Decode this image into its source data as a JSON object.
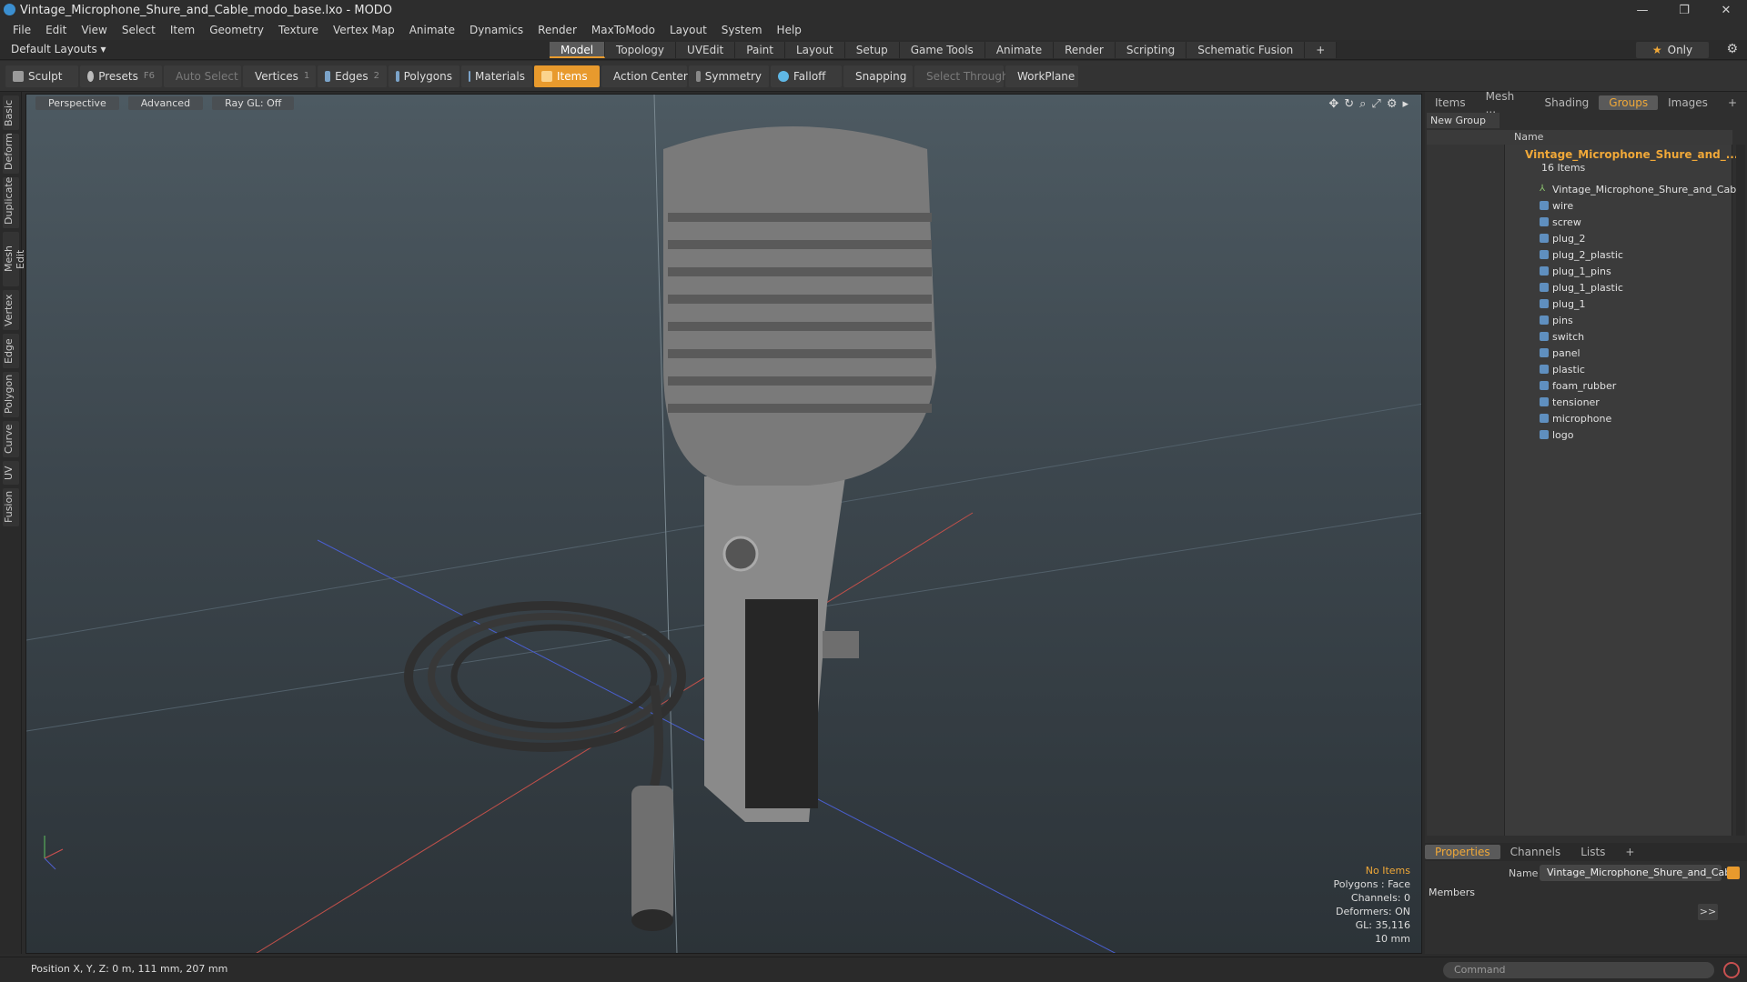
{
  "window": {
    "title": "Vintage_Microphone_Shure_and_Cable_modo_base.lxo - MODO"
  },
  "menu": [
    "File",
    "Edit",
    "View",
    "Select",
    "Item",
    "Geometry",
    "Texture",
    "Vertex Map",
    "Animate",
    "Dynamics",
    "Render",
    "MaxToModo",
    "Layout",
    "System",
    "Help"
  ],
  "layout": {
    "selector": "Default Layouts ▾",
    "tabs": [
      "Model",
      "Topology",
      "UVEdit",
      "Paint",
      "Layout",
      "Setup",
      "Game Tools",
      "Animate",
      "Render",
      "Scripting",
      "Schematic Fusion"
    ],
    "add": "+",
    "only": "Only"
  },
  "toolbar": {
    "sculpt": "Sculpt",
    "presets": "Presets",
    "presets_key": "F6",
    "auto_select": "Auto Select",
    "vertices": "Vertices",
    "vertices_num": "1",
    "edges": "Edges",
    "edges_num": "2",
    "polygons": "Polygons",
    "materials": "Materials",
    "items": "Items",
    "action_center": "Action Center",
    "symmetry": "Symmetry",
    "falloff": "Falloff",
    "snapping": "Snapping",
    "select_through": "Select Through",
    "workplane": "WorkPlane"
  },
  "left_tabs": [
    "Basic",
    "Deform",
    "Duplicate",
    "Mesh Edit",
    "Vertex",
    "Edge",
    "Polygon",
    "Curve",
    "UV",
    "Fusion"
  ],
  "viewport": {
    "perspective": "Perspective",
    "advanced": "Advanced",
    "raygl": "Ray GL: Off",
    "hud": {
      "no_items": "No Items",
      "polygons": "Polygons : Face",
      "channels": "Channels: 0",
      "deformers": "Deformers: ON",
      "gl": "GL: 35,116",
      "scale": "10 mm"
    }
  },
  "groups_panel": {
    "tabs": [
      "Items",
      "Mesh ...",
      "Shading",
      "Groups",
      "Images",
      "+"
    ],
    "new_group": "New Group",
    "col_name": "Name",
    "group_name": "Vintage_Microphone_Shure_and_...",
    "group_count": "16 Items",
    "items": [
      "Vintage_Microphone_Shure_and_Cable",
      "wire",
      "screw",
      "plug_2",
      "plug_2_plastic",
      "plug_1_pins",
      "plug_1_plastic",
      "plug_1",
      "pins",
      "switch",
      "panel",
      "plastic",
      "foam_rubber",
      "tensioner",
      "microphone",
      "logo"
    ]
  },
  "properties": {
    "tabs": [
      "Properties",
      "Channels",
      "Lists",
      "+"
    ],
    "name_label": "Name",
    "name_value": "Vintage_Microphone_Shure_and_Cable",
    "members": "Members",
    "arrow": ">>"
  },
  "status": {
    "position": "Position X, Y, Z:  0 m, 111 mm, 207 mm",
    "command_placeholder": "Command"
  }
}
